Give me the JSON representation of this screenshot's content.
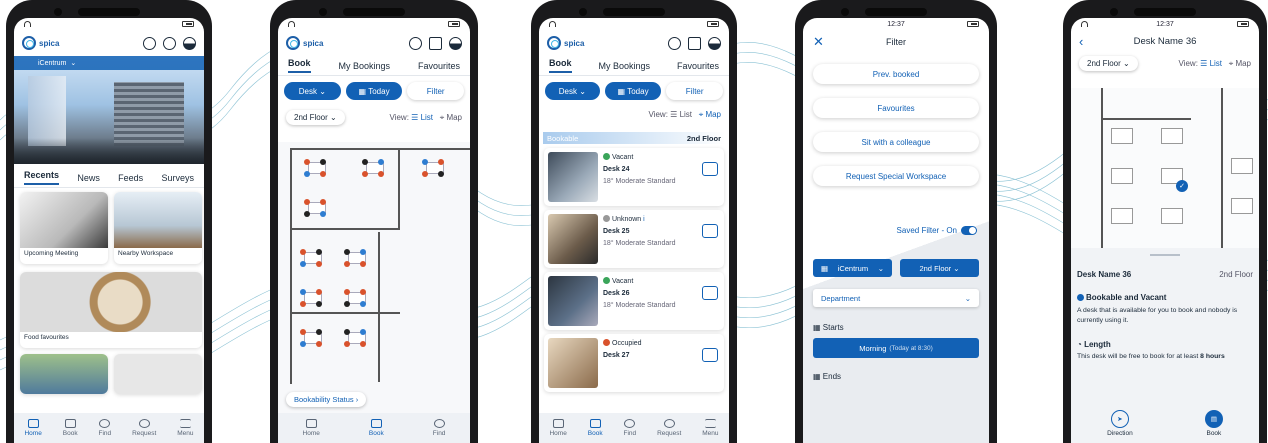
{
  "colors": {
    "brand": "#1261b5",
    "accent": "#41b6e6",
    "available": "#2e7dd1",
    "occupied": "#d9522c",
    "vacant": "#3aa55a"
  },
  "phone1": {
    "brand": "spica",
    "location": "iCentrum",
    "tabs": [
      "Recents",
      "News",
      "Feeds",
      "Surveys"
    ],
    "tiles": [
      "Upcoming Meeting",
      "Nearby Workspace",
      "Food favourites"
    ],
    "nav": [
      "Home",
      "Book",
      "Find",
      "Request",
      "Menu"
    ]
  },
  "phone2": {
    "brand": "spica",
    "tabs": [
      "Book",
      "My Bookings",
      "Favourites"
    ],
    "desk_btn": "Desk",
    "today_btn": "Today",
    "filter_btn": "Filter",
    "floor": "2nd Floor",
    "view_label": "View:",
    "list": "List",
    "map": "Map",
    "status_btn": "Bookability Status",
    "nav": [
      "Home",
      "Book",
      "Find"
    ]
  },
  "phone3": {
    "brand": "spica",
    "tabs": [
      "Book",
      "My Bookings",
      "Favourites"
    ],
    "desk_btn": "Desk",
    "today_btn": "Today",
    "filter_btn": "Filter",
    "view_label": "View:",
    "list": "List",
    "map": "Map",
    "section": "Bookable",
    "floor": "2nd Floor",
    "desks": [
      {
        "status": "Vacant",
        "name": "Desk 24",
        "meta": "18° Moderate Standard"
      },
      {
        "status": "Unknown",
        "name": "Desk 25",
        "meta": "18° Moderate Standard"
      },
      {
        "status": "Vacant",
        "name": "Desk 26",
        "meta": "18° Moderate Standard"
      },
      {
        "status": "Occupied",
        "name": "Desk 27",
        "meta": ""
      }
    ],
    "nav": [
      "Home",
      "Book",
      "Find",
      "Request",
      "Menu"
    ]
  },
  "phone4": {
    "time": "12:37",
    "title": "Filter",
    "buttons": [
      "Prev. booked",
      "Favourites",
      "Sit with a colleague",
      "Request Special Workspace"
    ],
    "saved_filter": "Saved Filter - On",
    "building": "iCentrum",
    "floor": "2nd Floor",
    "department": "Department",
    "starts_label": "Starts",
    "starts_value": "Morning",
    "starts_sub": "(Today at 8:30)",
    "ends_label": "Ends"
  },
  "phone5": {
    "time": "12:37",
    "title": "Desk Name 36",
    "floor": "2nd Floor",
    "view_label": "View:",
    "list": "List",
    "map": "Map",
    "desk_name": "Desk Name 36",
    "desk_floor": "2nd Floor",
    "status_title": "Bookable and Vacant",
    "status_desc": "A desk that is available for you to book and nobody is currently using it.",
    "length_title": "Length",
    "length_desc": "This desk will be free to book for at least",
    "length_value": "8 hours",
    "actions": [
      "Direction",
      "Book"
    ]
  }
}
